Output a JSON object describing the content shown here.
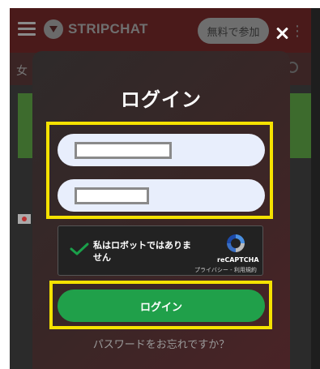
{
  "background": {
    "logo_text": "STRIPCHAT",
    "join_button": "無料で参加",
    "subbar_label": "女"
  },
  "modal": {
    "title": "ログイン",
    "username_field": {
      "value": "",
      "placeholder": ""
    },
    "password_field": {
      "value": "",
      "placeholder": ""
    },
    "recaptcha": {
      "label": "私はロボットではありません",
      "brand": "reCAPTCHA",
      "links": "プライバシー - 利用規約"
    },
    "login_button": "ログイン",
    "forgot_password": "パスワードをお忘れですか？"
  },
  "colors": {
    "highlight": "#f5e200",
    "login_button": "#20a04a",
    "field_background": "#e8eefc"
  },
  "icons": [
    "menu-icon",
    "stripchat-logo-icon",
    "close-icon",
    "search-icon",
    "checkmark-icon",
    "recaptcha-logo-icon"
  ]
}
